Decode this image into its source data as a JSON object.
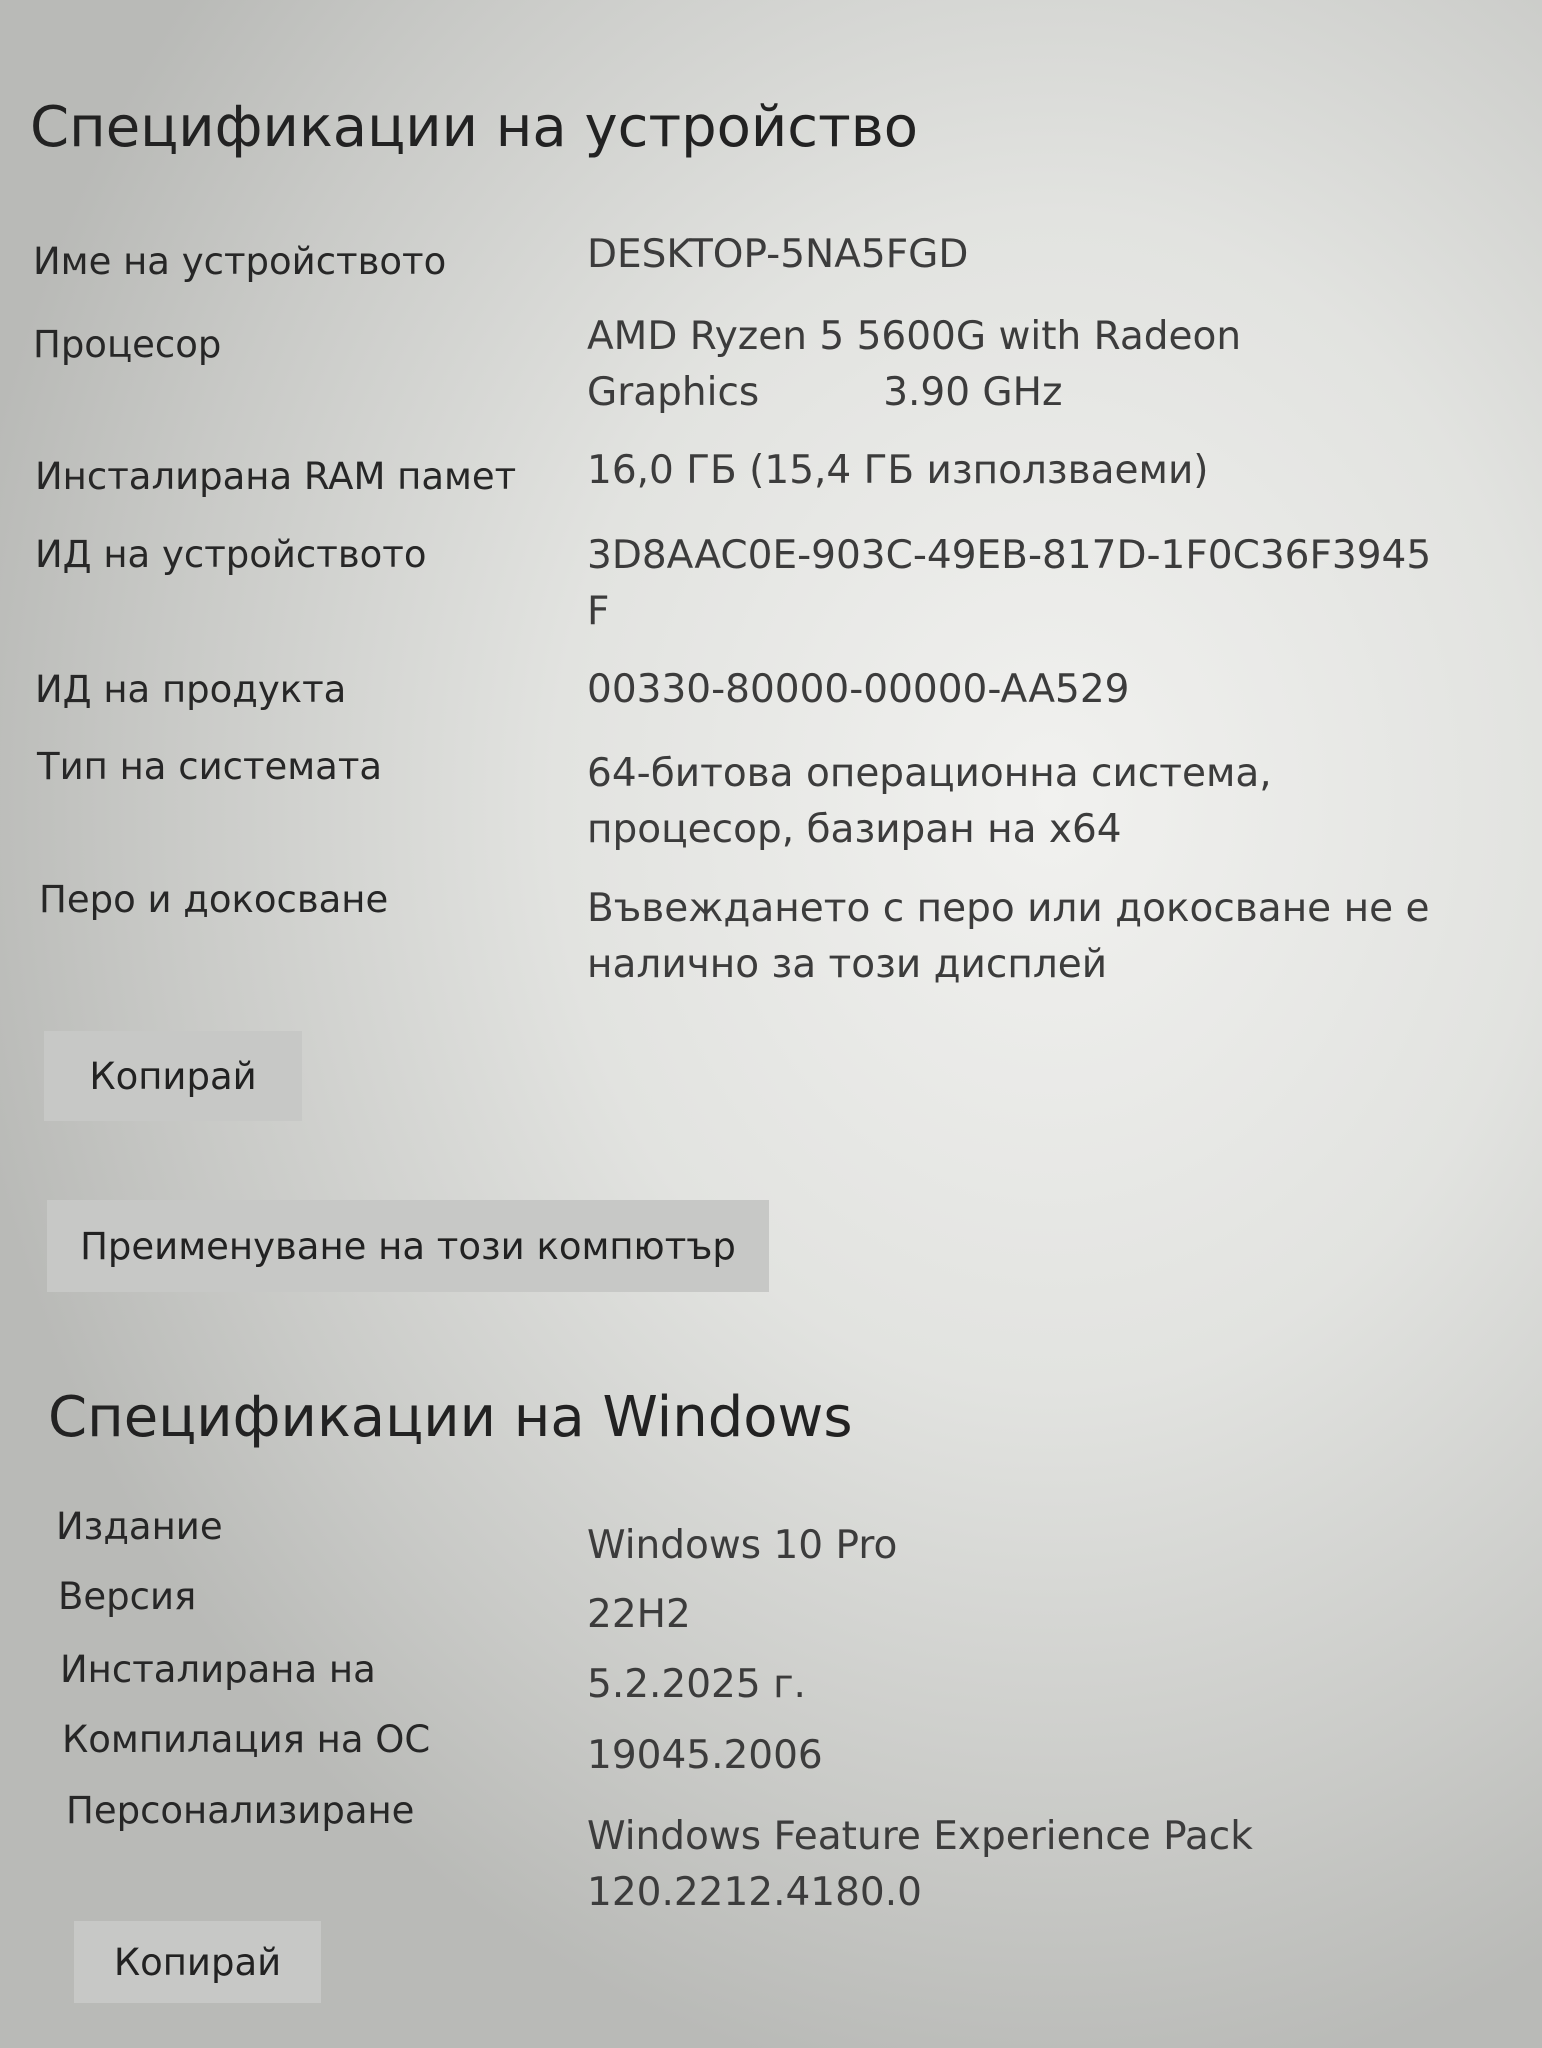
{
  "device_specs": {
    "title": "Спецификации на устройство",
    "rows": [
      {
        "label": "Име на устройството",
        "value": "DESKTOP-5NA5FGD"
      },
      {
        "label": "Процесор",
        "value": "AMD Ryzen 5 5600G with Radeon\nGraphics          3.90 GHz"
      },
      {
        "label": "Инсталирана RAM памет",
        "value": "16,0 ГБ (15,4 ГБ използваеми)"
      },
      {
        "label": "ИД на устройството",
        "value": "3D8AAC0E-903C-49EB-817D-1F0C36F3945\nF"
      },
      {
        "label": "ИД на продукта",
        "value": "00330-80000-00000-AA529"
      },
      {
        "label": "Тип на системата",
        "value": "64-битова операционна система,\nпроцесор, базиран на x64"
      },
      {
        "label": "Перо и докосване",
        "value": "Въвеждането с перо или докосване не е\nналично за този дисплей"
      }
    ],
    "copy_button": "Копирай",
    "rename_button": "Преименуване на този компютър"
  },
  "windows_specs": {
    "title": "Спецификации на Windows",
    "rows": [
      {
        "label": "Издание",
        "value": "Windows 10 Pro"
      },
      {
        "label": "Версия",
        "value": "22H2"
      },
      {
        "label": "Инсталирана на",
        "value": "5.2.2025 г."
      },
      {
        "label": "Компилация на ОС",
        "value": "19045.2006"
      },
      {
        "label": "Персонализиране",
        "value": "Windows Feature Experience Pack\n120.22​12.4180.0"
      }
    ],
    "copy_button": "Копирай"
  }
}
